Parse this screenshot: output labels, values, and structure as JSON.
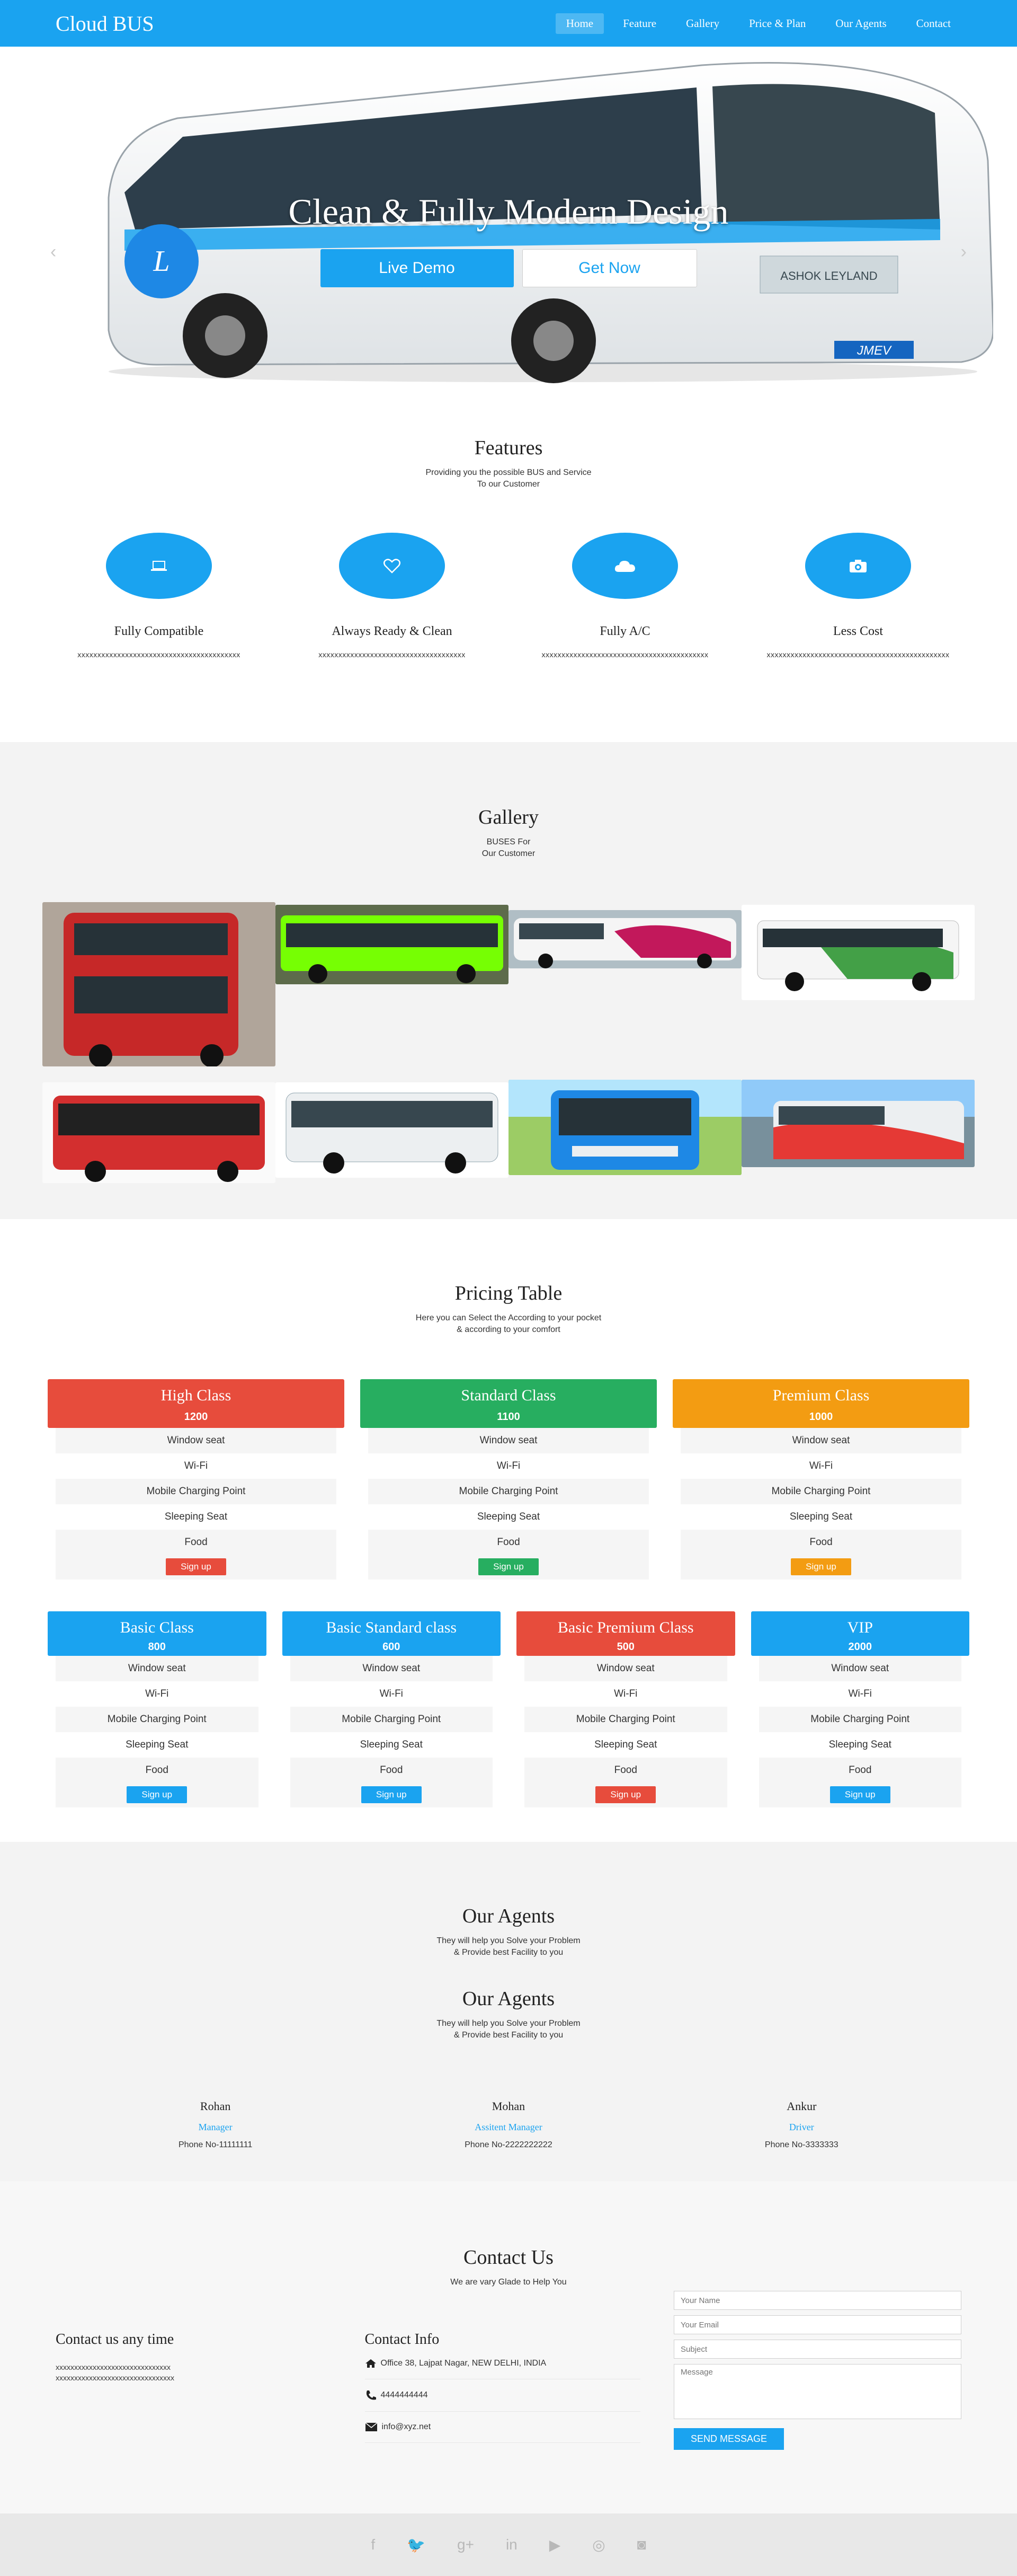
{
  "nav": {
    "brand": "Cloud BUS",
    "items": [
      {
        "label": "Home",
        "active": true
      },
      {
        "label": "Feature"
      },
      {
        "label": "Gallery"
      },
      {
        "label": "Price & Plan"
      },
      {
        "label": "Our Agents"
      },
      {
        "label": "Contact"
      }
    ]
  },
  "hero": {
    "title": "Clean & Fully Modern Design",
    "demo_label": "Live Demo",
    "get_label": "Get Now",
    "prev_arrow": "‹",
    "next_arrow": "›",
    "illustration": "bus-image",
    "bus_plate": "JMEV",
    "bus_brand": "ASHOK LEYLAND"
  },
  "features": {
    "title": "Features",
    "subtitle": "Providing you the possible BUS and Service\nTo our Customer",
    "items": [
      {
        "icon": "laptop-icon",
        "name": "Fully Compatible",
        "desc": "xxxxxxxxxxxxxxxxxxxxxxxxxxxxxxxxxxxxxxxxx"
      },
      {
        "icon": "heart-icon",
        "name": "Always Ready & Clean",
        "desc": "xxxxxxxxxxxxxxxxxxxxxxxxxxxxxxxxxxxxx"
      },
      {
        "icon": "cloud-icon",
        "name": "Fully A/C",
        "desc": "xxxxxxxxxxxxxxxxxxxxxxxxxxxxxxxxxxxxxxxxxx"
      },
      {
        "icon": "camera-icon",
        "name": "Less Cost",
        "desc": "xxxxxxxxxxxxxxxxxxxxxxxxxxxxxxxxxxxxxxxxxxxxxx"
      }
    ]
  },
  "gallery": {
    "title": "Gallery",
    "subtitle": "BUSES For\nOur Customer",
    "images": [
      {
        "name": "red-double-decker-bus-photo",
        "color": "#c62828"
      },
      {
        "name": "green-city-bus-photo",
        "color": "#4caf50"
      },
      {
        "name": "white-red-coach-photo",
        "color": "#b0bec5"
      },
      {
        "name": "white-green-bus-photo",
        "color": "#e8f5e9"
      },
      {
        "name": "red-city-bus-photo",
        "color": "#d32f2f"
      },
      {
        "name": "white-coach-photo",
        "color": "#eceff1"
      },
      {
        "name": "blue-bus-photo",
        "color": "#1e88e5"
      },
      {
        "name": "white-red-bus-photo",
        "color": "#90a4ae"
      }
    ]
  },
  "pricing": {
    "title": "Pricing Table",
    "subtitle": "Here you can Select the According to your pocket\n& according to your comfort",
    "features": [
      "Window seat",
      "Wi-Fi",
      "Mobile Charging Point",
      "Sleeping Seat",
      "Food"
    ],
    "signup_label": "Sign up",
    "row1": [
      {
        "name": "High Class",
        "price": "1200",
        "color": "#e74c3c"
      },
      {
        "name": "Standard Class",
        "price": "1100",
        "color": "#27ae60"
      },
      {
        "name": "Premium Class",
        "price": "1000",
        "color": "#f39c12"
      }
    ],
    "row2": [
      {
        "name": "Basic Class",
        "price": "800",
        "color": "#1aa3f0"
      },
      {
        "name": "Basic Standard class",
        "price": "600",
        "color": "#1aa3f0"
      },
      {
        "name": "Basic Premium Class",
        "price": "500",
        "color": "#e74c3c"
      },
      {
        "name": "VIP",
        "price": "2000",
        "color": "#1aa3f0"
      }
    ]
  },
  "agents": {
    "title": "Our Agents",
    "subtitle": "They will help you Solve your Problem\n& Provide best Facility to you",
    "title2": "Our Agents",
    "subtitle2": "They will help you Solve your Problem\n& Provide best Facility to you",
    "people": [
      {
        "name": "Rohan",
        "role": "Manager",
        "phone": "Phone No-11111111"
      },
      {
        "name": "Mohan",
        "role": "Assitent Manager",
        "phone": "Phone No-2222222222"
      },
      {
        "name": "Ankur",
        "role": "Driver",
        "phone": "Phone No-3333333"
      }
    ]
  },
  "contact": {
    "title": "Contact Us",
    "subtitle": "We are vary Glade to Help You",
    "col1_title": "Contact us any time",
    "col1_text": "xxxxxxxxxxxxxxxxxxxxxxxxxxxxxxx\nxxxxxxxxxxxxxxxxxxxxxxxxxxxxxxxx",
    "col2_title": "Contact Info",
    "address": "Office 38, Lajpat Nagar, NEW DELHI, INDIA",
    "phone": "4444444444",
    "email": "info@xyz.net",
    "form": {
      "name_ph": "Your Name",
      "email_ph": "Your Email",
      "subject_ph": "Subject",
      "message_ph": "Message",
      "send_label": "SEND MESSAGE"
    }
  },
  "footer": {
    "icons": [
      {
        "name": "facebook-icon",
        "glyph": "f"
      },
      {
        "name": "twitter-icon",
        "glyph": "🐦"
      },
      {
        "name": "google-plus-icon",
        "glyph": "g+"
      },
      {
        "name": "linkedin-icon",
        "glyph": "in"
      },
      {
        "name": "youtube-icon",
        "glyph": "▶"
      },
      {
        "name": "dribbble-icon",
        "glyph": "◎"
      },
      {
        "name": "instagram-icon",
        "glyph": "◙"
      }
    ]
  }
}
